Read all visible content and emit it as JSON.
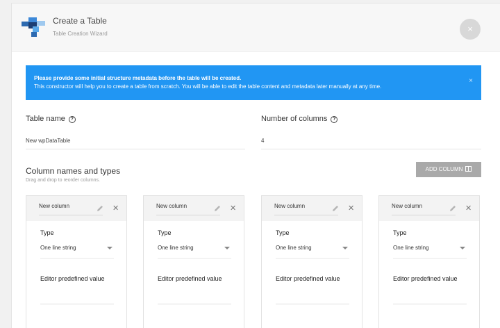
{
  "header": {
    "title": "Create a Table",
    "subtitle": "Table Creation Wizard",
    "close_symbol": "×"
  },
  "alert": {
    "title": "Please provide some initial structure metadata before the table will be created.",
    "text": "This constructor will help you to create a table from scratch. You will be able to edit the table content and metadata later manually at any time.",
    "close_symbol": "×",
    "color": "#2196f3"
  },
  "table_name": {
    "label": "Table name",
    "value": "New wpDataTable"
  },
  "num_columns": {
    "label": "Number of columns",
    "value": "4"
  },
  "help_symbol": "?",
  "columns_section": {
    "title": "Column names and types",
    "subtitle": "Drag and drop to reorder columns.",
    "add_button": "ADD COLUMN"
  },
  "columns": [
    {
      "name": "New column",
      "type_label": "Type",
      "type_value": "One line string",
      "editor_label": "Editor predefined value"
    },
    {
      "name": "New column",
      "type_label": "Type",
      "type_value": "One line string",
      "editor_label": "Editor predefined value"
    },
    {
      "name": "New column",
      "type_label": "Type",
      "type_value": "One line string",
      "editor_label": "Editor predefined value"
    },
    {
      "name": "New column",
      "type_label": "Type",
      "type_value": "One line string",
      "editor_label": "Editor predefined value"
    }
  ],
  "icons": {
    "logo": "table-logo-icon",
    "edit": "pencil-icon",
    "remove": "close-icon",
    "add_column": "columns-icon",
    "dropdown": "caret-down-icon"
  }
}
